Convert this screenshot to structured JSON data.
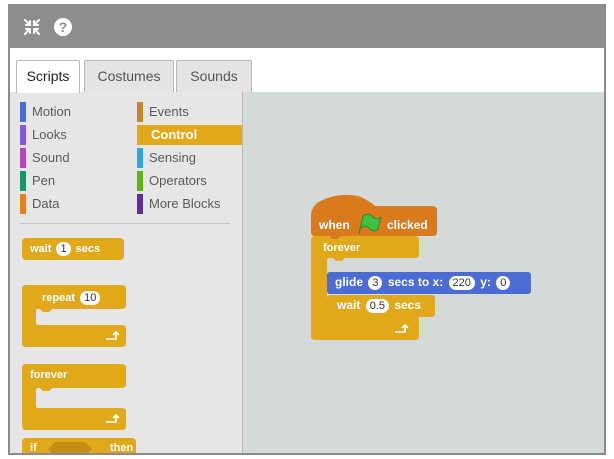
{
  "toolbar": {
    "collapse_icon": "collapse-arrows-icon",
    "help_icon": "help-icon"
  },
  "tabs": [
    {
      "label": "Scripts",
      "active": true
    },
    {
      "label": "Costumes",
      "active": false
    },
    {
      "label": "Sounds",
      "active": false
    }
  ],
  "categories": [
    {
      "label": "Motion",
      "color": "#4a6cd4"
    },
    {
      "label": "Looks",
      "color": "#8a55d7"
    },
    {
      "label": "Sound",
      "color": "#bb42c3"
    },
    {
      "label": "Pen",
      "color": "#0e9a6c"
    },
    {
      "label": "Data",
      "color": "#ee7d16"
    },
    {
      "label": "Events",
      "color": "#c88330"
    },
    {
      "label": "Control",
      "color": "#e1a91a",
      "selected": true
    },
    {
      "label": "Sensing",
      "color": "#2ca5e2"
    },
    {
      "label": "Operators",
      "color": "#5cb712"
    },
    {
      "label": "More Blocks",
      "color": "#632d99"
    }
  ],
  "palette_blocks": {
    "wait": {
      "label": "wait",
      "value": "1",
      "unit": "secs"
    },
    "repeat": {
      "label": "repeat",
      "value": "10"
    },
    "forever": {
      "label": "forever"
    },
    "if": {
      "label": "if",
      "then": "then"
    }
  },
  "script": {
    "hat": {
      "when": "when",
      "clicked": "clicked"
    },
    "forever": "forever",
    "glide": {
      "label": "glide",
      "secs": "3",
      "secs_to_x": "secs to x:",
      "x": "220",
      "y_label": "y:",
      "y": "0"
    },
    "wait": {
      "label": "wait",
      "value": "0.5",
      "unit": "secs"
    }
  },
  "colors": {
    "control": "#e1a91a",
    "events": "#d97a1d",
    "motion": "#4a6cd4",
    "flag": "#3ec13e",
    "script_bg": "#d4d9da",
    "palette_bg": "#e6e6e6",
    "topbar": "#8e8e8e"
  }
}
